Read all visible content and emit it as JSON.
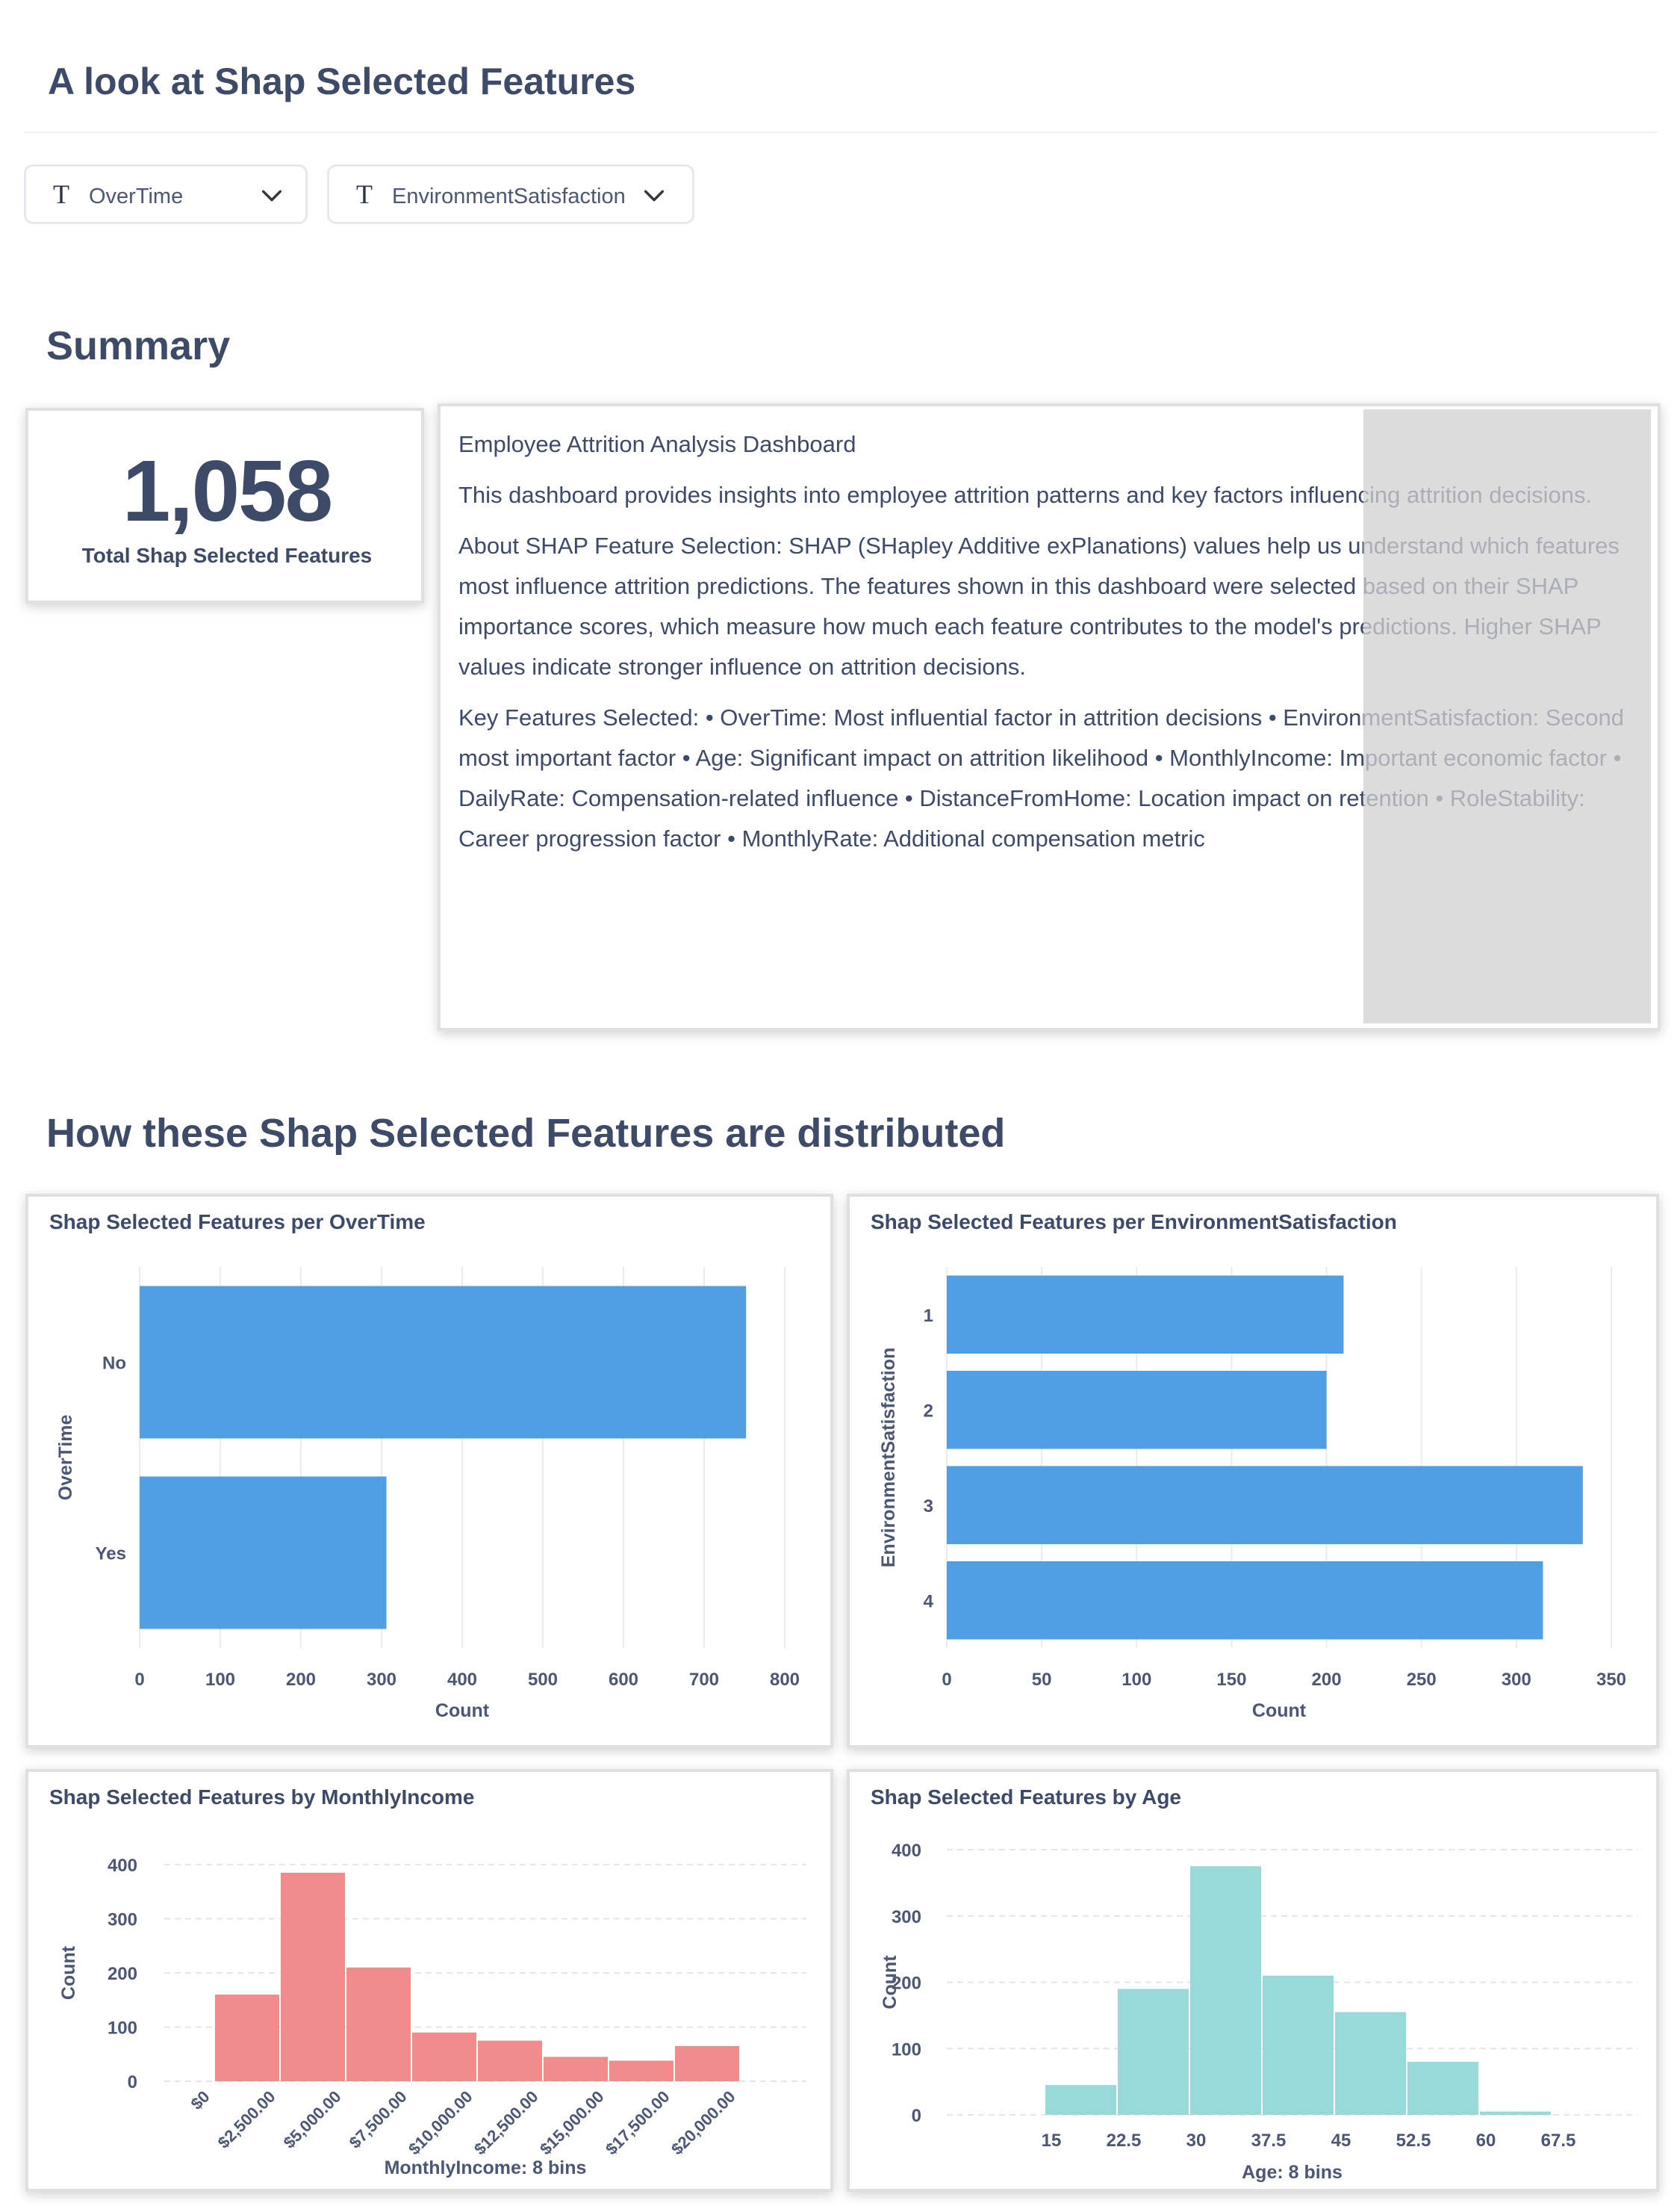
{
  "header": {
    "title": "A look at Shap Selected Features"
  },
  "filters": [
    {
      "label": "OverTime",
      "icon": "text-type-icon"
    },
    {
      "label": "EnvironmentSatisfaction",
      "icon": "text-type-icon"
    }
  ],
  "summary": {
    "heading": "Summary",
    "scalar": {
      "value": "1,058",
      "label": "Total Shap Selected Features"
    },
    "text": {
      "heading": "Employee Attrition Analysis Dashboard",
      "p1": "This dashboard provides insights into employee attrition patterns and key factors influencing attrition decisions.",
      "p2": "About SHAP Feature Selection: SHAP (SHapley Additive exPlanations) values help us understand which features most influence attrition predictions. The features shown in this dashboard were selected based on their SHAP importance scores, which measure how much each feature contributes to the model's predictions. Higher SHAP values indicate stronger influence on attrition decisions.",
      "p3": "Key Features Selected: • OverTime: Most influential factor in attrition decisions • EnvironmentSatisfaction: Second most important factor • Age: Significant impact on attrition likelihood • MonthlyIncome: Important economic factor • DailyRate: Compensation-related influence • DistanceFromHome: Location impact on retention • RoleStability: Career progression factor • MonthlyRate: Additional compensation metric"
    }
  },
  "distribution": {
    "heading": "How these Shap Selected Features are distributed"
  },
  "colors": {
    "blue": "#509ee3",
    "salmon": "#ef8c8c",
    "teal": "#98d9d9",
    "text": "#3d4a68"
  },
  "chart_data": [
    {
      "type": "bar",
      "orientation": "horizontal",
      "title": "Shap Selected Features per OverTime",
      "categories": [
        "No",
        "Yes"
      ],
      "values": [
        752,
        306
      ],
      "xlabel": "Count",
      "ylabel": "OverTime",
      "xlim": [
        0,
        800
      ],
      "xticks": [
        "0",
        "100",
        "200",
        "300",
        "400",
        "500",
        "600",
        "700",
        "800"
      ],
      "grid": true
    },
    {
      "type": "bar",
      "orientation": "horizontal",
      "title": "Shap Selected Features per EnvironmentSatisfaction",
      "categories": [
        "1",
        "2",
        "3",
        "4"
      ],
      "values": [
        209,
        200,
        335,
        314
      ],
      "xlabel": "Count",
      "ylabel": "EnvironmentSatisfaction",
      "xlim": [
        0,
        350
      ],
      "xticks": [
        "0",
        "50",
        "100",
        "150",
        "200",
        "250",
        "300",
        "350"
      ],
      "grid": true
    },
    {
      "type": "bar",
      "subtype": "histogram",
      "title": "Shap Selected Features by MonthlyIncome",
      "categories": [
        "$2,500.00",
        "$5,000.00",
        "$7,500.00",
        "$10,000.00",
        "$12,500.00",
        "$15,000.00",
        "$17,500.00",
        "$20,000.00"
      ],
      "values": [
        160,
        385,
        210,
        90,
        75,
        45,
        38,
        65
      ],
      "xticks": [
        "$0",
        "$2,500.00",
        "$5,000.00",
        "$7,500.00",
        "$10,000.00",
        "$12,500.00",
        "$15,000.00",
        "$17,500.00",
        "$20,000.00"
      ],
      "xlabel": "MonthlyIncome: 8 bins",
      "ylabel": "Count",
      "ylim": [
        0,
        400
      ],
      "yticks": [
        "0",
        "100",
        "200",
        "300",
        "400"
      ],
      "grid": true
    },
    {
      "type": "bar",
      "subtype": "histogram",
      "title": "Shap Selected Features by Age",
      "categories": [
        "15",
        "22.5",
        "30",
        "37.5",
        "45",
        "52.5",
        "60",
        "67.5"
      ],
      "values": [
        45,
        190,
        375,
        210,
        155,
        80,
        5,
        0
      ],
      "xticks": [
        "15",
        "22.5",
        "30",
        "37.5",
        "45",
        "52.5",
        "60",
        "67.5"
      ],
      "xlabel": "Age: 8 bins",
      "ylabel": "Count",
      "ylim": [
        0,
        400
      ],
      "yticks": [
        "0",
        "100",
        "200",
        "300",
        "400"
      ],
      "grid": true
    }
  ]
}
